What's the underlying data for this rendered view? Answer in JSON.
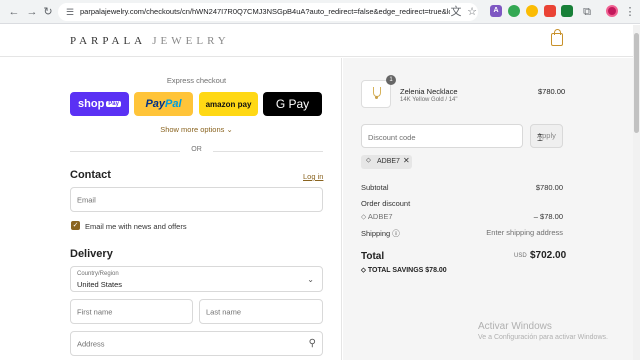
{
  "browser": {
    "url": "parpalajewelry.com/checkouts/cn/hWN247I7R0Q7CMJ3NSGpB4uA?auto_redirect=false&edge_redirect=true&locale...",
    "icons": [
      "back-icon",
      "forward-icon",
      "reload-icon",
      "tune-icon",
      "translate-icon",
      "star-icon"
    ]
  },
  "header": {
    "logo_main": "PARPALA",
    "logo_sub": "JEWELRY"
  },
  "checkout": {
    "express_label": "Express checkout",
    "shop_pay": "shop",
    "shop_pay_pill": "Pay",
    "paypal_a": "Pay",
    "paypal_b": "Pal",
    "amazon_pay": "amazon pay",
    "google_pay": "G Pay",
    "show_more": "Show more options ⌄",
    "or": "OR",
    "contact_title": "Contact",
    "login": "Log in",
    "email_placeholder": "Email",
    "news_label": "Email me with news and offers",
    "delivery_title": "Delivery",
    "country_label": "Country/Region",
    "country_value": "United States",
    "first_name": "First name",
    "last_name": "Last name",
    "address": "Address"
  },
  "summary": {
    "qty": "1",
    "item_name": "Zelenia Necklace",
    "item_variant": "14K Yellow Gold / 14\"",
    "item_price": "$780.00",
    "discount_placeholder": "Discount code",
    "apply": "Apply",
    "code": "ADBE7",
    "subtotal_label": "Subtotal",
    "subtotal_value": "$780.00",
    "order_discount_label": "Order discount",
    "discount_code": "ADBE7",
    "discount_value": "– $78.00",
    "shipping_label": "Shipping",
    "shipping_value": "Enter shipping address",
    "total_label": "Total",
    "total_currency": "USD",
    "total_value": "$702.00",
    "savings": "TOTAL SAVINGS  $78.00"
  },
  "os": {
    "watermark_title": "Activar Windows",
    "watermark_sub": "Ve a Configuración para activar Windows."
  }
}
